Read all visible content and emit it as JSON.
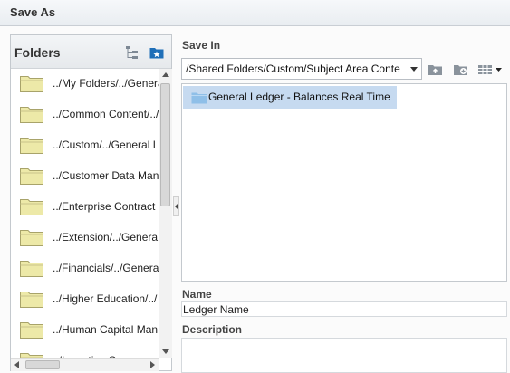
{
  "dialog": {
    "title": "Save As"
  },
  "folders": {
    "heading": "Folders",
    "items": [
      {
        "label": "../My Folders/../Genera"
      },
      {
        "label": "../Common Content/../"
      },
      {
        "label": "../Custom/../General L"
      },
      {
        "label": "../Customer Data Man"
      },
      {
        "label": "../Enterprise Contract"
      },
      {
        "label": "../Extension/../Genera"
      },
      {
        "label": "../Financials/../Genera"
      },
      {
        "label": "../Higher Education/../"
      },
      {
        "label": "../Human Capital Man"
      },
      {
        "label": "../Incentive Compens"
      }
    ]
  },
  "save_in": {
    "label": "Save In",
    "path": "/Shared Folders/Custom/Subject Area Conte",
    "items": [
      {
        "label": "General Ledger - Balances Real Time"
      }
    ]
  },
  "name": {
    "label": "Name",
    "value": "Ledger Name"
  },
  "description": {
    "label": "Description",
    "value": ""
  },
  "colors": {
    "selection": "#c6daf0",
    "folder_yellow": "#ede9a8",
    "folder_blue": "#8fbfe8",
    "accent_blue": "#1f6fb8"
  }
}
